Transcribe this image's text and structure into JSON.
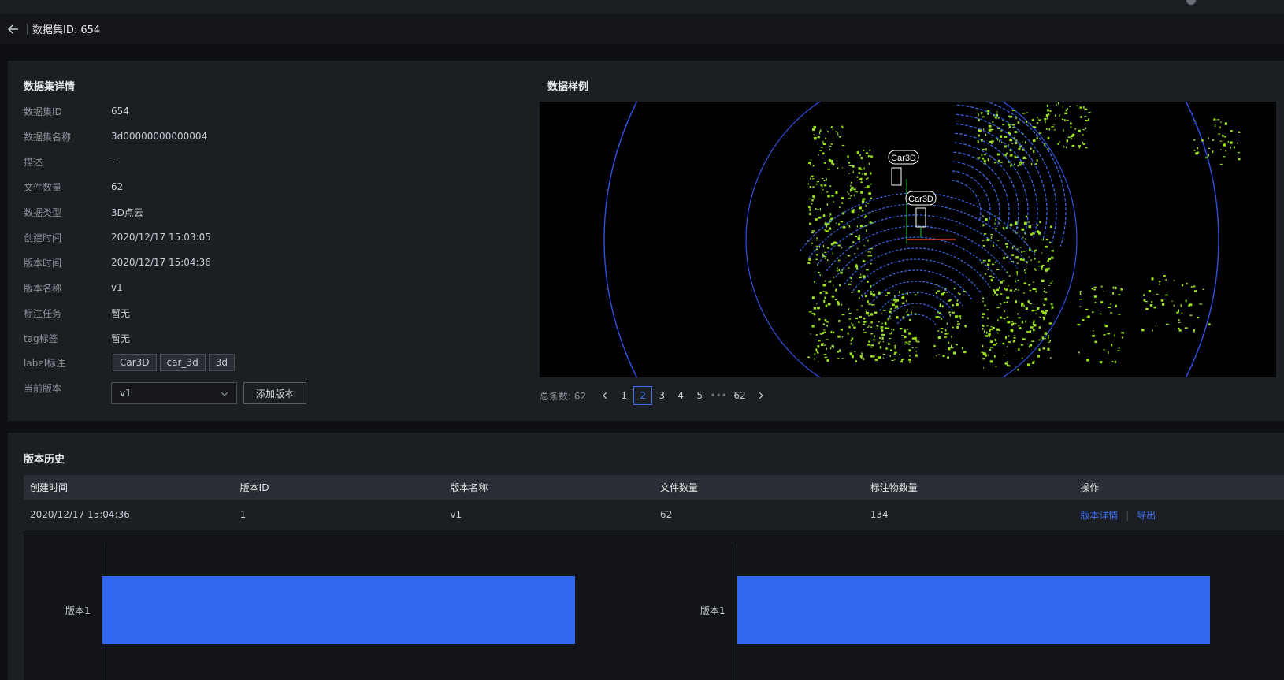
{
  "header": {
    "back_icon": "arrow-left-icon",
    "title": "数据集ID: 654"
  },
  "details": {
    "title": "数据集详情",
    "rows": [
      {
        "label": "数据集ID",
        "value": "654"
      },
      {
        "label": "数据集名称",
        "value": "3d00000000000004"
      },
      {
        "label": "描述",
        "value": "--"
      },
      {
        "label": "文件数量",
        "value": "62"
      },
      {
        "label": "数据类型",
        "value": "3D点云"
      },
      {
        "label": "创建时间",
        "value": "2020/12/17 15:03:05"
      },
      {
        "label": "版本时间",
        "value": "2020/12/17 15:04:36"
      },
      {
        "label": "版本名称",
        "value": "v1"
      },
      {
        "label": "标注任务",
        "value": "暂无"
      },
      {
        "label": "tag标签",
        "value": "暂无"
      }
    ],
    "label_row": {
      "label": "label标注",
      "tags": [
        "Car3D",
        "car_3d",
        "3d"
      ]
    },
    "version_row": {
      "label": "当前版本",
      "selected": "v1",
      "add_button": "添加版本"
    }
  },
  "sample": {
    "title": "数据样例",
    "box_labels": [
      "Car3D",
      "Car3D"
    ],
    "colors": {
      "points": "#9be31c",
      "rings": "#3a6bf0",
      "background": "#000000"
    },
    "pager": {
      "total_label": "总条数: 62",
      "pages": [
        "1",
        "2",
        "3",
        "4",
        "5"
      ],
      "current": "2",
      "ellipsis": "•••",
      "last": "62"
    }
  },
  "history": {
    "title": "版本历史",
    "columns": [
      "创建时间",
      "版本ID",
      "版本名称",
      "文件数量",
      "标注物数量",
      "操作"
    ],
    "rows": [
      {
        "created": "2020/12/17 15:04:36",
        "id": "1",
        "name": "v1",
        "files": "62",
        "annotations": "134",
        "action_detail": "版本详情",
        "action_export": "导出"
      }
    ]
  },
  "chart_data": [
    {
      "type": "bar",
      "categories": [
        "版本1"
      ],
      "values": [
        62
      ],
      "xlim": [
        0,
        62
      ]
    },
    {
      "type": "bar",
      "categories": [
        "版本1"
      ],
      "values": [
        134
      ],
      "xlim": [
        0,
        134
      ]
    }
  ]
}
